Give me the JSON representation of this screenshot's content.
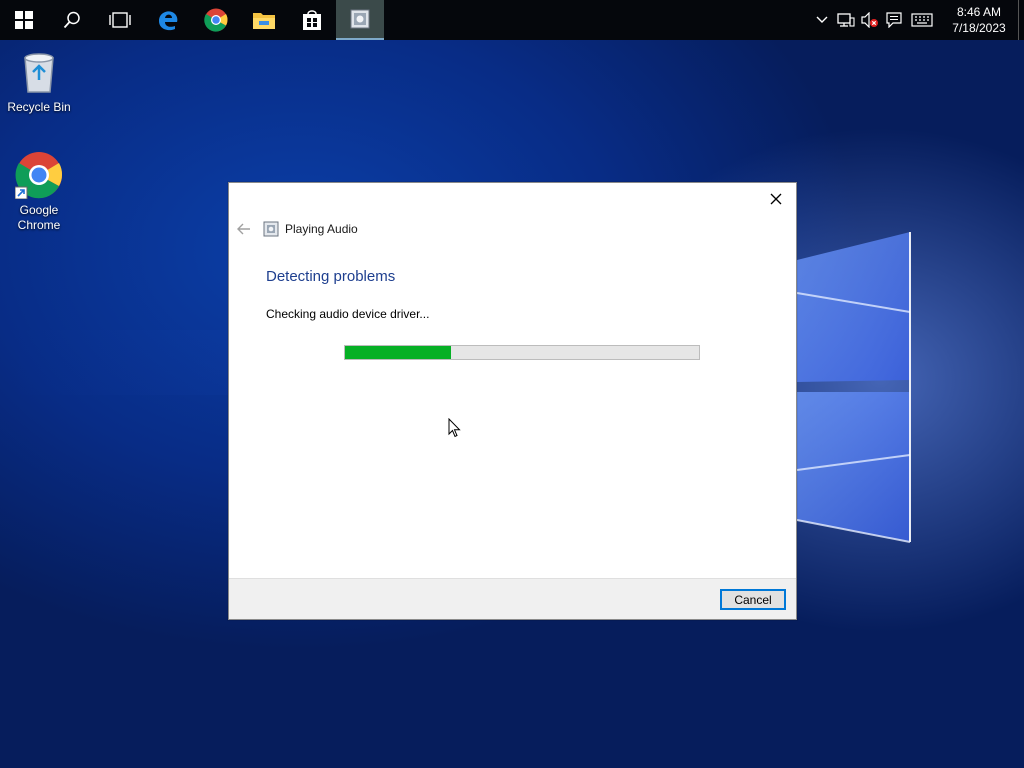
{
  "taskbar": {
    "items": [
      {
        "name": "start-button",
        "icon": "windows-icon"
      },
      {
        "name": "search-button",
        "icon": "search-icon"
      },
      {
        "name": "task-view-button",
        "icon": "task-view-icon"
      },
      {
        "name": "edge-button",
        "icon": "edge-icon"
      },
      {
        "name": "chrome-button",
        "icon": "chrome-icon"
      },
      {
        "name": "file-explorer-button",
        "icon": "folder-icon"
      },
      {
        "name": "store-button",
        "icon": "store-icon"
      },
      {
        "name": "troubleshooter-button",
        "icon": "troubleshooter-icon",
        "active": true
      }
    ],
    "tray": {
      "icons": [
        "chevron-up-icon",
        "network-icon",
        "volume-muted-icon",
        "action-center-icon",
        "keyboard-icon"
      ],
      "time": "8:46 AM",
      "date": "7/18/2023"
    }
  },
  "desktop": {
    "icons": [
      {
        "label": "Recycle Bin",
        "icon": "recycle-bin-icon"
      },
      {
        "label": "Google Chrome",
        "icon": "chrome-icon"
      }
    ]
  },
  "dialog": {
    "wizard_title": "Playing Audio",
    "heading": "Detecting problems",
    "status": "Checking audio device driver...",
    "progress_fraction": 0.3,
    "cancel_label": "Cancel"
  },
  "colors": {
    "heading": "#1e3f8f",
    "progress_fill": "#06b025",
    "button_focus": "#0078d7",
    "taskbar": "#05070c"
  }
}
